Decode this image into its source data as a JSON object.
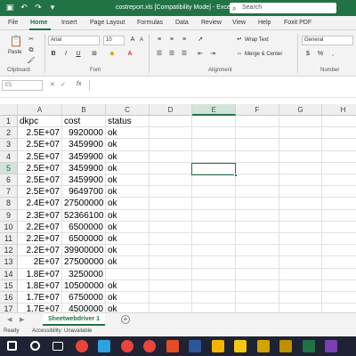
{
  "window": {
    "title": "costreport.xls [Compatibility Mode]  -  Excel",
    "search_placeholder": "Search"
  },
  "menu": [
    "File",
    "Home",
    "Insert",
    "Page Layout",
    "Formulas",
    "Data",
    "Review",
    "View",
    "Help",
    "Foxit PDF"
  ],
  "ribbon": {
    "paste_label": "Paste",
    "font_name": "Arial",
    "font_size": "10",
    "wrap_text": "Wrap Text",
    "merge_center": "Merge & Center",
    "number_format": "General",
    "groups": {
      "clipboard": "Clipboard",
      "font": "Font",
      "alignment": "Alignment",
      "number": "Number"
    }
  },
  "formula_bar": {
    "name_box": "E5",
    "fx": "fx",
    "content": ""
  },
  "columns": [
    "A",
    "B",
    "C",
    "D",
    "E",
    "F",
    "G",
    "H"
  ],
  "selected_cell": {
    "column": "E",
    "row": 5
  },
  "rows": [
    {
      "n": "1",
      "a": "dkpc",
      "b": "cost",
      "c": "status"
    },
    {
      "n": "2",
      "a": "2.5E+07",
      "b": "9920000",
      "c": "ok"
    },
    {
      "n": "3",
      "a": "2.5E+07",
      "b": "3459900",
      "c": "ok"
    },
    {
      "n": "4",
      "a": "2.5E+07",
      "b": "3459900",
      "c": "ok"
    },
    {
      "n": "5",
      "a": "2.5E+07",
      "b": "3459900",
      "c": "ok"
    },
    {
      "n": "6",
      "a": "2.5E+07",
      "b": "3459900",
      "c": "ok"
    },
    {
      "n": "7",
      "a": "2.5E+07",
      "b": "9649700",
      "c": "ok"
    },
    {
      "n": "8",
      "a": "2.4E+07",
      "b": "27500000",
      "c": "ok"
    },
    {
      "n": "9",
      "a": "2.3E+07",
      "b": "52366100",
      "c": "ok"
    },
    {
      "n": "10",
      "a": "2.2E+07",
      "b": "6500000",
      "c": "ok"
    },
    {
      "n": "11",
      "a": "2.2E+07",
      "b": "6500000",
      "c": "ok"
    },
    {
      "n": "12",
      "a": "2.2E+07",
      "b": "39900000",
      "c": "ok"
    },
    {
      "n": "13",
      "a": "2E+07",
      "b": "27500000",
      "c": "ok"
    },
    {
      "n": "14",
      "a": "1.8E+07",
      "b": "3250000",
      "c": ""
    },
    {
      "n": "15",
      "a": "1.8E+07",
      "b": "10500000",
      "c": "ok"
    },
    {
      "n": "16",
      "a": "1.7E+07",
      "b": "6750000",
      "c": "ok"
    },
    {
      "n": "17",
      "a": "1.7E+07",
      "b": "4500000",
      "c": "ok"
    }
  ],
  "sheet_tab": "Sheetwebdriver 1",
  "status": {
    "ready": "Ready",
    "accessibility": "Accessibility: Unavailable"
  },
  "colors": {
    "accent": "#217346",
    "taskbar": "#1f2233"
  },
  "taskbar_icons": [
    "windows-start-icon",
    "search-icon",
    "task-view-icon",
    "chrome-icon",
    "telegram-icon",
    "chrome-icon",
    "chrome-icon",
    "media-icon",
    "word-icon",
    "files-icon",
    "folder-icon",
    "app-icon",
    "app-icon",
    "excel-icon",
    "app-icon"
  ]
}
